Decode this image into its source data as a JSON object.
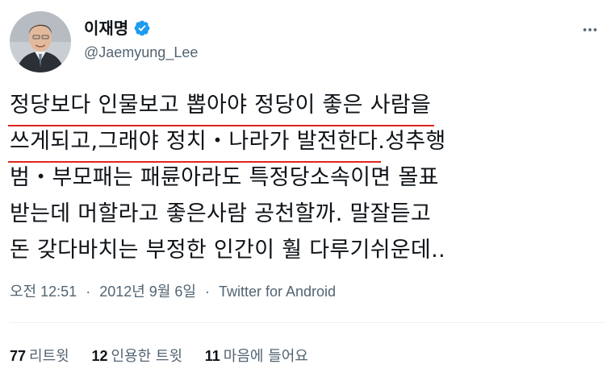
{
  "user": {
    "display_name": "이재명",
    "handle": "@Jaemyung_Lee"
  },
  "tweet": {
    "lines": [
      {
        "underlined": "정당보다 인물보고 뽑아야 정당이 좋은 사람을",
        "rest": ""
      },
      {
        "underlined": "쓰게되고,그래야 정치・나라가 발전한다",
        "rest": ".성추행"
      },
      {
        "underlined": "",
        "rest": "범・부모패는 패륜아라도 특정당소속이면 몰표"
      },
      {
        "underlined": "",
        "rest": "받는데 머할라고 좋은사람 공천할까. 말잘듣고"
      },
      {
        "underlined": "",
        "rest": "돈 갖다바치는 부정한 인간이 훨 다루기쉬운데.."
      }
    ]
  },
  "meta": {
    "time": "오전 12:51",
    "sep1": "·",
    "date": "2012년 9월 6일",
    "sep2": "·",
    "source": "Twitter for Android"
  },
  "stats": {
    "retweets": {
      "count": "77",
      "label": "리트윗"
    },
    "quotes": {
      "count": "12",
      "label": "인용한 트윗"
    },
    "likes": {
      "count": "11",
      "label": "마음에 들어요"
    }
  },
  "colors": {
    "verified": "#1d9bf0",
    "annotation_underline": "#e0241f",
    "secondary_text": "#536471"
  },
  "icons": {
    "verified": "verified-badge-icon",
    "more": "more-options-icon"
  }
}
